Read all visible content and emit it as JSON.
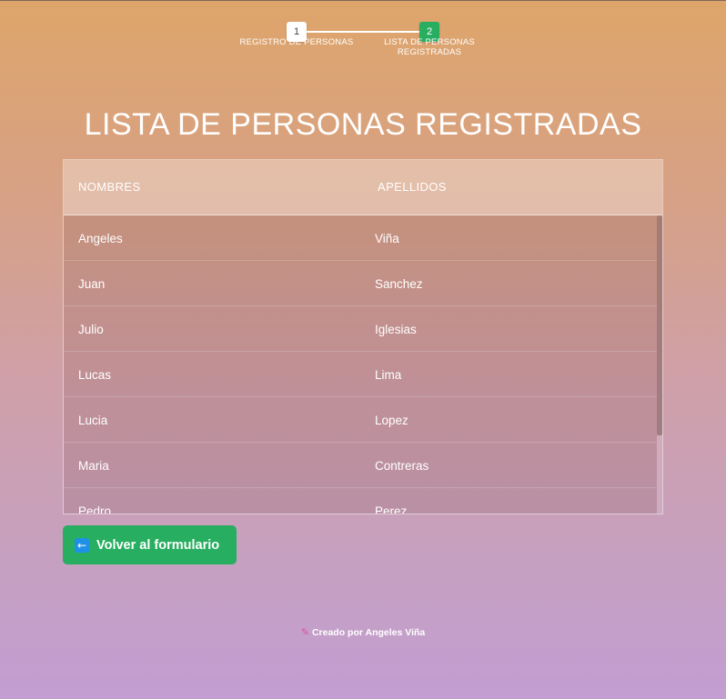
{
  "stepper": {
    "steps": [
      {
        "number": "1",
        "label": "REGISTRO DE PERSONAS"
      },
      {
        "number": "2",
        "label": "LISTA DE PERSONAS REGISTRADAS"
      }
    ]
  },
  "page": {
    "title": "LISTA DE PERSONAS REGISTRADAS"
  },
  "table": {
    "headers": [
      "NOMBRES",
      "APELLIDOS"
    ],
    "rows": [
      {
        "nombre": "Angeles",
        "apellido": "Viña"
      },
      {
        "nombre": "Juan",
        "apellido": "Sanchez"
      },
      {
        "nombre": "Julio",
        "apellido": "Iglesias"
      },
      {
        "nombre": "Lucas",
        "apellido": "Lima"
      },
      {
        "nombre": "Lucia",
        "apellido": "Lopez"
      },
      {
        "nombre": "Maria",
        "apellido": "Contreras"
      },
      {
        "nombre": "Pedro",
        "apellido": "Perez"
      }
    ]
  },
  "actions": {
    "back_label": "Volver al formulario",
    "back_icon": "arrow-left-icon"
  },
  "footer": {
    "text": "Creado por Angeles Viña",
    "icon": "pencil-icon"
  },
  "colors": {
    "accent": "#27ae60",
    "step_active": "#27ae60",
    "back_icon_bg": "#1e90e8"
  }
}
